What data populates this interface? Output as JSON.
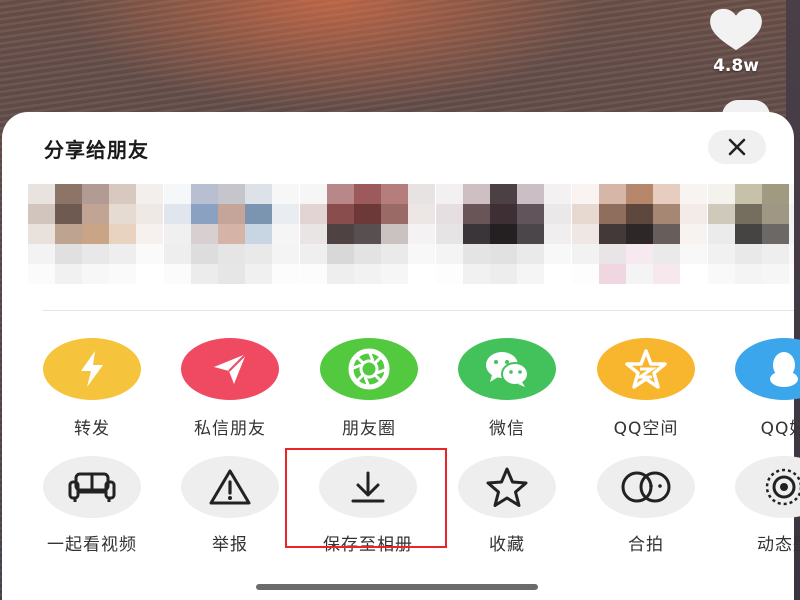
{
  "video": {
    "like_count": "4.8w"
  },
  "share_sheet": {
    "title": "分享给朋友",
    "close_icon": "close-icon",
    "friends": [
      {
        "colors": [
          "#e9e3df",
          "#8c7467",
          "#b29b92",
          "#d7c9c0",
          "#f3efec",
          "#d1c5bd",
          "#6f5a52",
          "#c2a494",
          "#e6dbd2",
          "#efe9e6",
          "#e8e1dc",
          "#bda390",
          "#caa487",
          "#e7d3c0",
          "#f6f1ee",
          "#f3f3f3",
          "#e0e0e0",
          "#e8e8e8",
          "#eeeeee",
          "#fafafa",
          "#fbfbfb",
          "#f1f1f1",
          "#f7f7f7",
          "#fafafa",
          "#ffffff"
        ]
      },
      {
        "colors": [
          "#f6f7f9",
          "#b8bfd0",
          "#c7c5cc",
          "#dde2e9",
          "#f7f7f7",
          "#e1e6ee",
          "#8aa1c2",
          "#c5a599",
          "#7b95b1",
          "#e9edf2",
          "#f0f0f0",
          "#d8cfd0",
          "#d6b3a7",
          "#c8d5e2",
          "#f5f5f5",
          "#eeeeee",
          "#dddddd",
          "#e5e5e5",
          "#e9e9e9",
          "#f4f4f4",
          "#fbfbfb",
          "#ececec",
          "#e6e6e6",
          "#f0f0f0",
          "#fcfcfc"
        ]
      },
      {
        "colors": [
          "#f6f6f6",
          "#b78789",
          "#9c5b5a",
          "#b57d7c",
          "#e7e3e3",
          "#e2d4d2",
          "#8a4d4d",
          "#6d3838",
          "#9a6a67",
          "#ece6e5",
          "#e9e5e4",
          "#4e4242",
          "#585050",
          "#c9c2c1",
          "#f4f2f2",
          "#efefef",
          "#d8d8d8",
          "#e3e3e3",
          "#eaeaea",
          "#f8f8f8",
          "#fcfcfc",
          "#eeeeee",
          "#f2f2f2",
          "#f6f6f6",
          "#ffffff"
        ]
      },
      {
        "colors": [
          "#f2f0f1",
          "#cdbfc2",
          "#4b4043",
          "#cbbec4",
          "#f3f1f2",
          "#e5dfe1",
          "#695457",
          "#3d2f33",
          "#62545b",
          "#ebe8e9",
          "#e7e4e5",
          "#3a3538",
          "#241f21",
          "#4b464a",
          "#f0eeef",
          "#f4f4f4",
          "#e4e4e4",
          "#e1e1e1",
          "#eaeaea",
          "#f8f8f8",
          "#fdfdfd",
          "#f1f1f1",
          "#ededed",
          "#f5f5f5",
          "#ffffff"
        ]
      },
      {
        "colors": [
          "#f9f4f1",
          "#d6b6a7",
          "#b7876b",
          "#e6cdbf",
          "#f8f4f2",
          "#e7d8d0",
          "#8f6e5d",
          "#5e473c",
          "#a58774",
          "#f2ebe7",
          "#eee7e3",
          "#443939",
          "#2e2727",
          "#675d5a",
          "#f6f3f1",
          "#f2f2f2",
          "#e9e5e6",
          "#f6e9ef",
          "#eaeaea",
          "#f8f8f8",
          "#fdfdfd",
          "#efd6e1",
          "#f4f4f4",
          "#f7e8ee",
          "#ffffff"
        ]
      },
      {
        "colors": [
          "#f3f2ec",
          "#c6c2aa",
          "#9f9a80",
          "#f7f7f5",
          "#fdfdfd",
          "#cfc9bc",
          "#756d5e",
          "#9f9684",
          "#f2f2f2",
          "#fdfdfd",
          "#ebebeb",
          "#464442",
          "#6b6865",
          "#f3f3f3",
          "#ffffff",
          "#f1f1f1",
          "#e9e9e9",
          "#eeeeee",
          "#f8f8f8",
          "#ffffff",
          "#f9f9f9",
          "#f4f4f4",
          "#f6f6f6",
          "#fcfcfc",
          "#ffffff"
        ]
      }
    ],
    "share_targets": [
      {
        "label": "转发",
        "icon": "lightning-icon",
        "color": "#f5c43c"
      },
      {
        "label": "私信朋友",
        "icon": "paper-plane-icon",
        "color": "#ef4a62"
      },
      {
        "label": "朋友圈",
        "icon": "moments-camera-icon",
        "color": "#52c93f"
      },
      {
        "label": "微信",
        "icon": "wechat-icon",
        "color": "#43c15a"
      },
      {
        "label": "QQ空间",
        "icon": "qzone-star-icon",
        "color": "#f7b62d"
      },
      {
        "label": "QQ好",
        "icon": "qq-penguin-icon",
        "color": "#3ba6ec"
      }
    ],
    "actions": [
      {
        "label": "一起看视频",
        "icon": "sofa-icon"
      },
      {
        "label": "举报",
        "icon": "warning-icon"
      },
      {
        "label": "保存至相册",
        "icon": "download-icon"
      },
      {
        "label": "收藏",
        "icon": "star-icon"
      },
      {
        "label": "合拍",
        "icon": "duet-icon"
      },
      {
        "label": "动态壁",
        "icon": "live-wallpaper-icon"
      }
    ],
    "highlight_color": "#e8262a"
  }
}
